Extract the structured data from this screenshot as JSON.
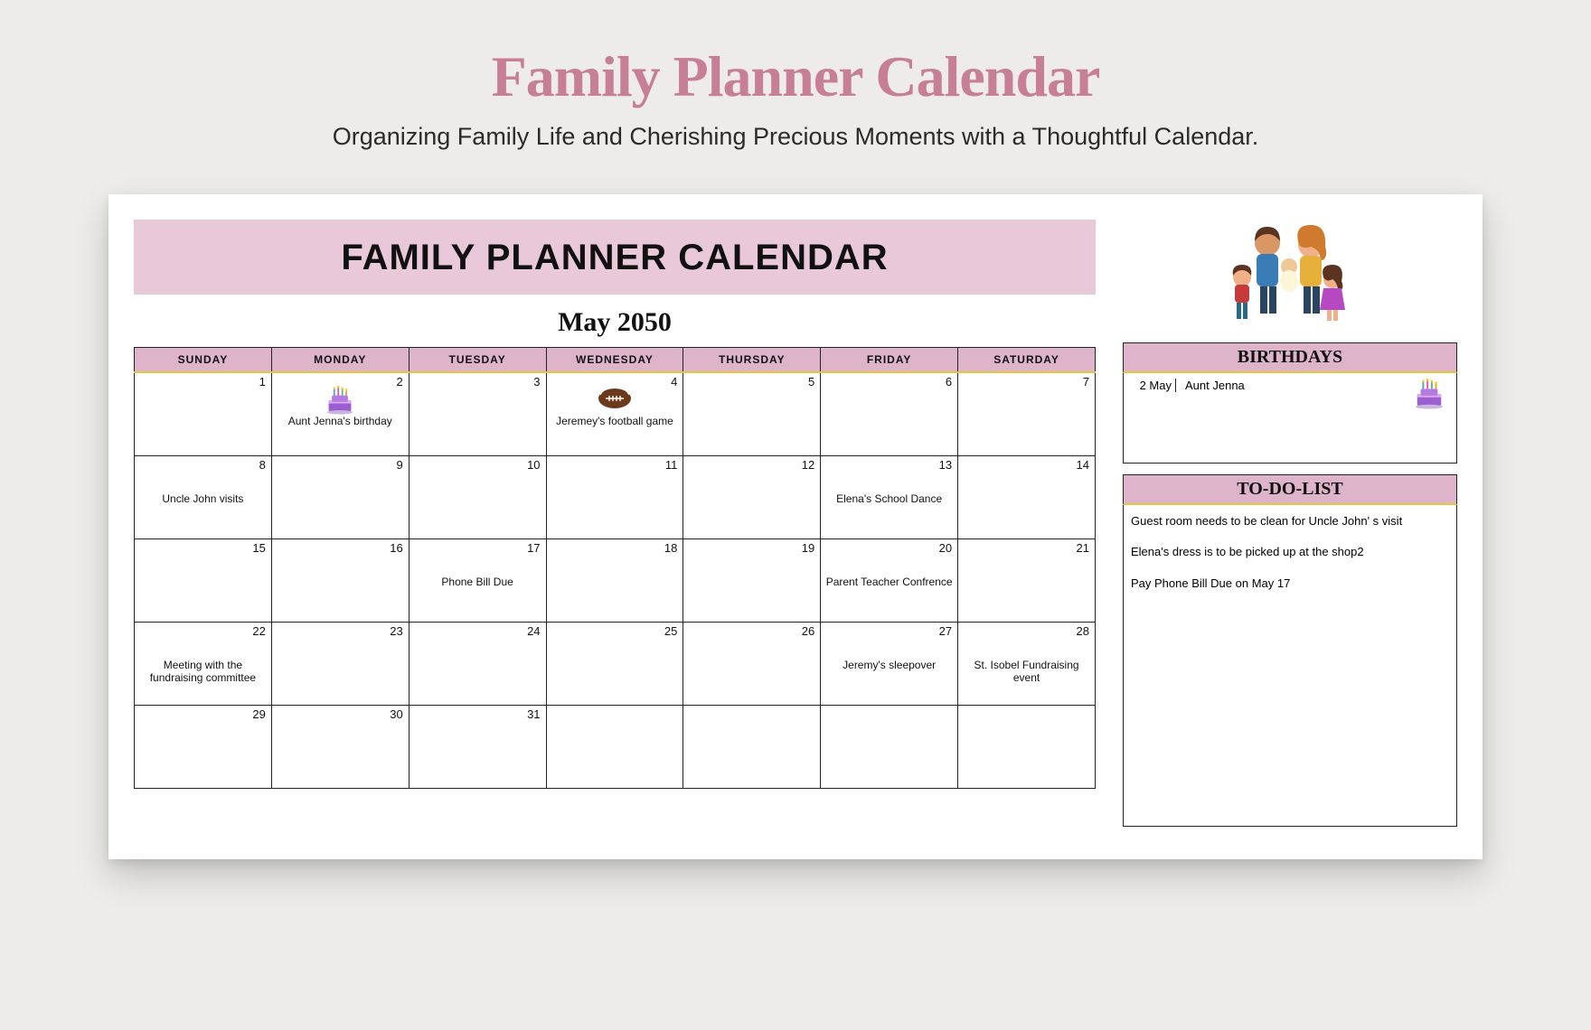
{
  "page": {
    "title": "Family Planner Calendar",
    "subtitle": "Organizing Family Life and Cherishing Precious Moments with a Thoughtful Calendar."
  },
  "calendar": {
    "banner": "FAMILY PLANNER CALENDAR",
    "month_label": "May 2050",
    "day_headers": [
      "SUNDAY",
      "MONDAY",
      "TUESDAY",
      "WEDNESDAY",
      "THURSDAY",
      "FRIDAY",
      "SATURDAY"
    ],
    "weeks": [
      [
        {
          "num": "1"
        },
        {
          "num": "2",
          "icon": "cake",
          "event": "Aunt Jenna's birthday"
        },
        {
          "num": "3"
        },
        {
          "num": "4",
          "icon": "football",
          "event": "Jeremey's football game"
        },
        {
          "num": "5"
        },
        {
          "num": "6"
        },
        {
          "num": "7"
        }
      ],
      [
        {
          "num": "8",
          "event": "Uncle John visits"
        },
        {
          "num": "9"
        },
        {
          "num": "10"
        },
        {
          "num": "11"
        },
        {
          "num": "12"
        },
        {
          "num": "13",
          "event": "Elena's School Dance"
        },
        {
          "num": "14"
        }
      ],
      [
        {
          "num": "15"
        },
        {
          "num": "16"
        },
        {
          "num": "17",
          "event": "Phone Bill Due"
        },
        {
          "num": "18"
        },
        {
          "num": "19"
        },
        {
          "num": "20",
          "event": "Parent Teacher Confrence"
        },
        {
          "num": "21"
        }
      ],
      [
        {
          "num": "22",
          "event": "Meeting with the fundraising committee"
        },
        {
          "num": "23"
        },
        {
          "num": "24"
        },
        {
          "num": "25"
        },
        {
          "num": "26"
        },
        {
          "num": "27",
          "event": "Jeremy's sleepover"
        },
        {
          "num": "28",
          "event": "St. Isobel Fundraising event"
        }
      ],
      [
        {
          "num": "29"
        },
        {
          "num": "30"
        },
        {
          "num": "31"
        },
        {
          "num": ""
        },
        {
          "num": ""
        },
        {
          "num": ""
        },
        {
          "num": ""
        }
      ]
    ]
  },
  "sidebar": {
    "birthdays_header": "BIRTHDAYS",
    "birthday": {
      "date": "2 May",
      "name": "Aunt Jenna"
    },
    "todo_header": "TO-DO-LIST",
    "todos": [
      "Guest room needs to be clean for Uncle John' s visit",
      "Elena's dress is to be picked up at the shop2",
      "Pay Phone Bill Due on May 17"
    ]
  }
}
